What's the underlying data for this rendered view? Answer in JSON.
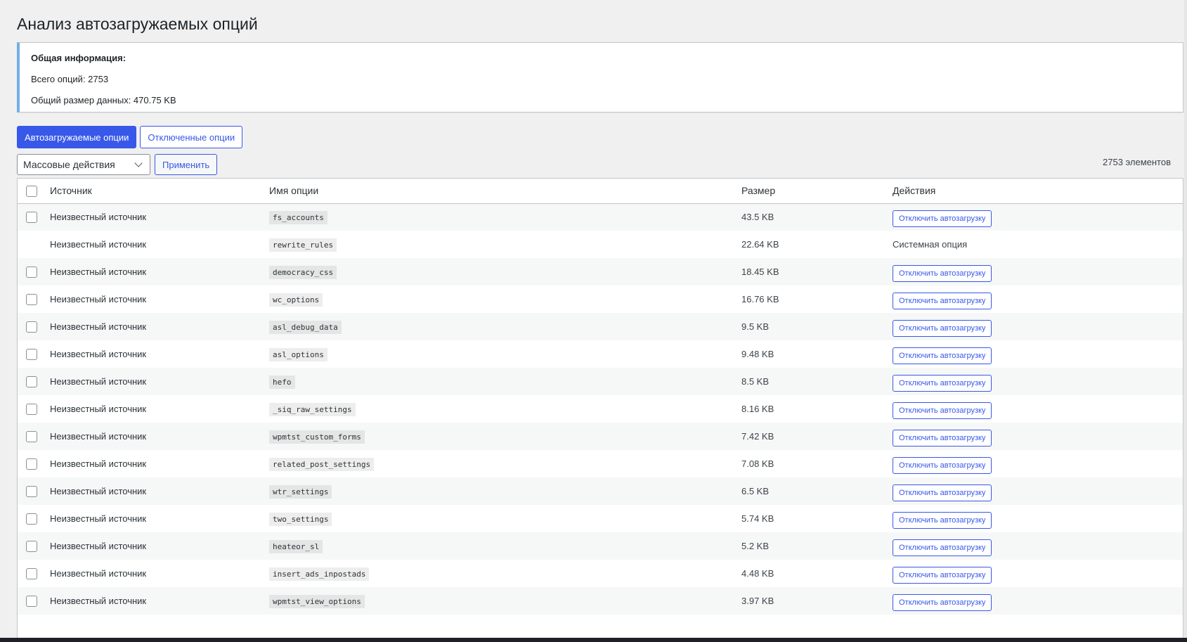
{
  "page": {
    "title": "Анализ автозагружаемых опций"
  },
  "info": {
    "heading": "Общая информация:",
    "total_options": "Всего опций: 2753",
    "total_size": "Общий размер данных: 470.75 KB"
  },
  "tabs": [
    {
      "label": "Автозагружаемые опции",
      "active": true
    },
    {
      "label": "Отключенные опции",
      "active": false
    }
  ],
  "bulk": {
    "selected": "Массовые действия",
    "apply_label": "Применить"
  },
  "items_count": "2753 элементов",
  "table": {
    "headers": {
      "source": "Источник",
      "name": "Имя опции",
      "size": "Размер",
      "actions": "Действия"
    },
    "action_label": "Отключить автозагрузку",
    "rows": [
      {
        "source": "Неизвестный источник",
        "name": "fs_accounts",
        "size": "43.5 KB",
        "system": false
      },
      {
        "source": "Неизвестный источник",
        "name": "rewrite_rules",
        "size": "22.64 KB",
        "system": true,
        "system_label": "Системная опция"
      },
      {
        "source": "Неизвестный источник",
        "name": "democracy_css",
        "size": "18.45 KB",
        "system": false
      },
      {
        "source": "Неизвестный источник",
        "name": "wc_options",
        "size": "16.76 KB",
        "system": false
      },
      {
        "source": "Неизвестный источник",
        "name": "asl_debug_data",
        "size": "9.5 KB",
        "system": false
      },
      {
        "source": "Неизвестный источник",
        "name": "asl_options",
        "size": "9.48 KB",
        "system": false
      },
      {
        "source": "Неизвестный источник",
        "name": "hefo",
        "size": "8.5 KB",
        "system": false
      },
      {
        "source": "Неизвестный источник",
        "name": "_siq_raw_settings",
        "size": "8.16 KB",
        "system": false
      },
      {
        "source": "Неизвестный источник",
        "name": "wpmtst_custom_forms",
        "size": "7.42 KB",
        "system": false
      },
      {
        "source": "Неизвестный источник",
        "name": "related_post_settings",
        "size": "7.08 KB",
        "system": false
      },
      {
        "source": "Неизвестный источник",
        "name": "wtr_settings",
        "size": "6.5 KB",
        "system": false
      },
      {
        "source": "Неизвестный источник",
        "name": "two_settings",
        "size": "5.74 KB",
        "system": false
      },
      {
        "source": "Неизвестный источник",
        "name": "heateor_sl",
        "size": "5.2 KB",
        "system": false
      },
      {
        "source": "Неизвестный источник",
        "name": "insert_ads_inpostads",
        "size": "4.48 KB",
        "system": false
      },
      {
        "source": "Неизвестный источник",
        "name": "wpmtst_view_options",
        "size": "3.97 KB",
        "system": false
      }
    ]
  },
  "colors": {
    "accent": "#3858e9",
    "info_border": "#72aee6",
    "background": "#f0f0f1"
  }
}
